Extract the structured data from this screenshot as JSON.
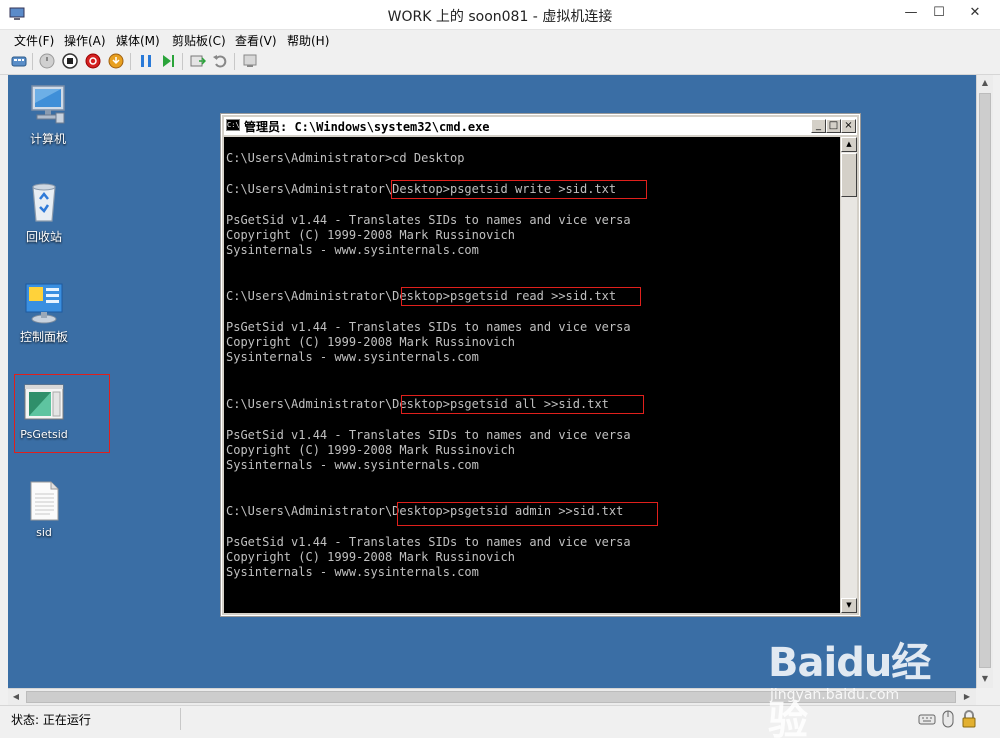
{
  "window": {
    "title": "WORK 上的 soon081 - 虚拟机连接",
    "minimize": "—",
    "maximize": "☐",
    "close": "✕"
  },
  "menu": [
    "文件(F)",
    "操作(A)",
    "媒体(M)",
    "剪贴板(C)",
    "查看(V)",
    "帮助(H)"
  ],
  "toolbar_icons": [
    "ctrl-alt-del-icon",
    "start-icon",
    "turn-off-icon",
    "shutdown-icon",
    "save-icon",
    "pause-icon",
    "reset-icon",
    "checkpoint-icon",
    "revert-icon",
    "enhanced-session-icon"
  ],
  "desktop": {
    "icons": [
      {
        "name": "computer-icon",
        "label": "计算机"
      },
      {
        "name": "recycle-bin-icon",
        "label": "回收站"
      },
      {
        "name": "control-panel-icon",
        "label": "控制面板"
      },
      {
        "name": "psgetsid-icon",
        "label": "PsGetsid"
      },
      {
        "name": "text-file-icon",
        "label": "sid"
      }
    ]
  },
  "cmd": {
    "title": "管理员: C:\\Windows\\system32\\cmd.exe",
    "lines": [
      "C:\\Users\\Administrator>cd Desktop",
      "",
      "C:\\Users\\Administrator\\Desktop>psgetsid write >sid.txt",
      "",
      "PsGetSid v1.44 - Translates SIDs to names and vice versa",
      "Copyright (C) 1999-2008 Mark Russinovich",
      "Sysinternals - www.sysinternals.com",
      "",
      "",
      "C:\\Users\\Administrator\\Desktop>psgetsid read >>sid.txt",
      "",
      "PsGetSid v1.44 - Translates SIDs to names and vice versa",
      "Copyright (C) 1999-2008 Mark Russinovich",
      "Sysinternals - www.sysinternals.com",
      "",
      "",
      "C:\\Users\\Administrator\\Desktop>psgetsid all >>sid.txt",
      "",
      "PsGetSid v1.44 - Translates SIDs to names and vice versa",
      "Copyright (C) 1999-2008 Mark Russinovich",
      "Sysinternals - www.sysinternals.com",
      "",
      "",
      "C:\\Users\\Administrator\\Desktop>psgetsid admin >>sid.txt",
      "",
      "PsGetSid v1.44 - Translates SIDs to names and vice versa",
      "Copyright (C) 1999-2008 Mark Russinovich",
      "Sysinternals - www.sysinternals.com"
    ]
  },
  "status": {
    "text": "状态: 正在运行"
  },
  "watermark": {
    "brand": "Baidu经验",
    "url": "jingyan.baidu.com"
  },
  "colors": {
    "desktop": "#3a6ea5",
    "highlight": "#e0201c",
    "console_bg": "#000000",
    "console_fg": "#c0c0c0"
  }
}
